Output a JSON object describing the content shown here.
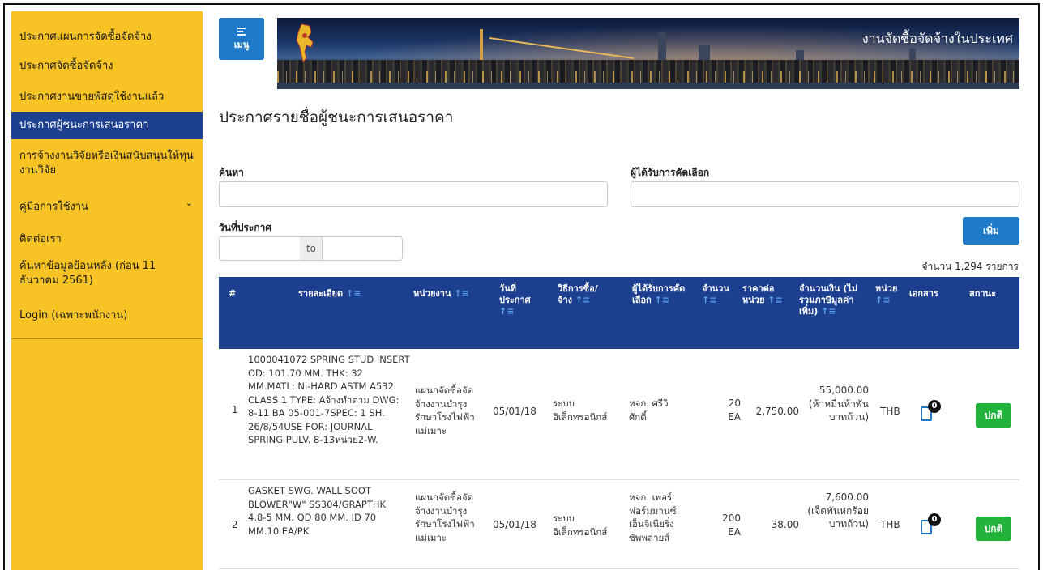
{
  "sidebar": {
    "items": [
      {
        "label": "ประกาศแผนการจัดซื้อจัดจ้าง"
      },
      {
        "label": "ประกาศจัดซื้อจัดจ้าง"
      },
      {
        "label": "ประกาศงานขายพัสดุใช้งานแล้ว"
      },
      {
        "label": "ประกาศผู้ชนะการเสนอราคา",
        "active": true
      },
      {
        "label": "การจ้างงานวิจัยหรือเงินสนับสนุนให้ทุนงานวิจัย"
      },
      {
        "label": "คู่มือการใช้งาน",
        "chevron": "chevron-down-icon"
      },
      {
        "label": "ติดต่อเรา"
      },
      {
        "label": "ค้นหาข้อมูลย้อนหลัง (ก่อน 11 ธันวาคม 2561)"
      },
      {
        "label": "Login (เฉพาะพนักงาน)"
      }
    ]
  },
  "header": {
    "menu_label": "เมนู",
    "banner_title": "งานจัดซื้อจัดจ้างในประเทศ"
  },
  "main": {
    "page_title": "ประกาศรายชื่อผู้ชนะการเสนอราคา",
    "search_label": "ค้นหา",
    "search_value": "",
    "winner_label": "ผู้ได้รับการคัดเลือก",
    "winner_value": "",
    "date_label": "วันที่ประกาศ",
    "date_to": "to",
    "add_button": "เพิ่ม",
    "count_text": "จำนวน 1,294 รายการ"
  },
  "table": {
    "headers": [
      {
        "label": "#"
      },
      {
        "label": "รายละเอียด",
        "sortable": true
      },
      {
        "label": "หน่วยงาน",
        "sortable": true
      },
      {
        "label": "วันที่ประกาศ",
        "sortable": true
      },
      {
        "label": "วิธีการซื้อ/จ้าง",
        "sortable": true
      },
      {
        "label": "ผู้ได้รับการคัดเลือก",
        "sortable": true
      },
      {
        "label": "จำนวน",
        "sortable": true
      },
      {
        "label": "ราคาต่อหน่วย",
        "sortable": true
      },
      {
        "label": "จำนวนเงิน (ไม่รวมภาษีมูลค่าเพิ่ม)",
        "sortable": true
      },
      {
        "label": "หน่วย",
        "sortable": true
      },
      {
        "label": "เอกสาร"
      },
      {
        "label": "สถานะ"
      }
    ],
    "rows": [
      {
        "num": "1",
        "detail": "1000041072 SPRING STUD INSERT OD: 101.70 MM. THK: 32 MM.MATL: Ni-HARD ASTM A532 CLASS 1 TYPE: Aจ้างทำตาม DWG: 8-11 BA 05-001-7SPEC: 1 SH. 26/8/54USE FOR: JOURNAL SPRING PULV. 8-13หน่วย2-W.",
        "dept": "แผนกจัดซื้อจัดจ้างงานบำรุงรักษาโรงไฟฟ้าแม่เมาะ",
        "date": "05/01/18",
        "method": "ระบบอิเล็กทรอนิกส์",
        "winner": "หจก. ศรีวิศักดิ์",
        "qty": "20 EA",
        "unit_price": "2,750.00",
        "amount": "55,000.00 (ห้าหมื่นห้าพันบาทถ้วน)",
        "currency": "THB",
        "docs": "0",
        "status": "ปกติ"
      },
      {
        "num": "2",
        "detail": "GASKET SWG. WALL SOOT BLOWER\"W\" SS304/GRAPTHK 4.8-5 MM. OD 80 MM. ID 70 MM.10 EA/PK",
        "dept": "แผนกจัดซื้อจัดจ้างงานบำรุงรักษาโรงไฟฟ้าแม่เมาะ",
        "date": "05/01/18",
        "method": "ระบบอิเล็กทรอนิกส์",
        "winner": "หจก. เพอร์ฟอร์มมานซ์ เอ็นจิเนียริ่ง ซัพพลายส์",
        "qty": "200 EA",
        "unit_price": "38.00",
        "amount": "7,600.00 (เจ็ดพันหกร้อยบาทถ้วน)",
        "currency": "THB",
        "docs": "0",
        "status": "ปกติ"
      }
    ]
  },
  "colors": {
    "sidebar_bg": "#f7c325",
    "active_bg": "#1d3f8f",
    "header_bg": "#1d3f8f",
    "primary_button": "#1f7bc9",
    "status_green": "#22b33a"
  }
}
